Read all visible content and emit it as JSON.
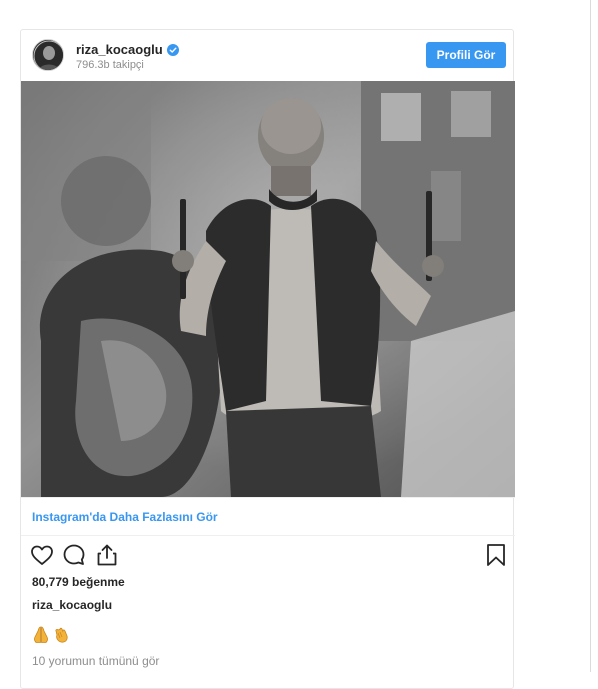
{
  "post": {
    "username": "riza_kocaoglu",
    "followers": "796.3b takipçi",
    "profile_button": "Profili Gör",
    "photo_description_icon": "photo",
    "more_link": "Instagram'da Daha Fazlasını Gör",
    "likes": "80,779 beğenme",
    "caption_username": "riza_kocaoglu",
    "caption_emojis": [
      "praying-hands-emoji",
      "clapping-hands-emoji"
    ],
    "comments_link": "10 yorumun tümünü gör"
  },
  "colors": {
    "accent": "#3897f0",
    "text": "#262626",
    "muted": "#8e8e8e",
    "border": "#e6e6e6",
    "emoji": "#f3b23a"
  }
}
